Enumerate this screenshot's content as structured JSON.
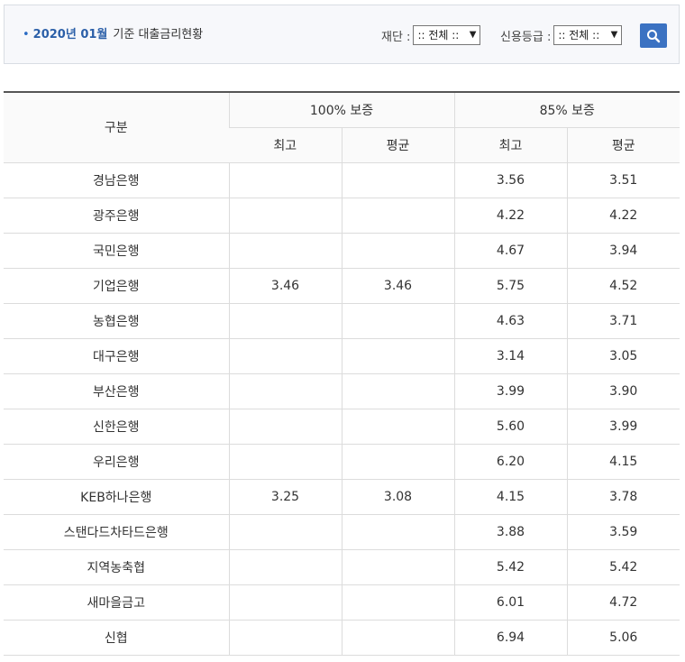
{
  "filter": {
    "bullet": "•",
    "date": "2020년 01월",
    "title": "기준 대출금리현황",
    "fund_label": "재단 :",
    "fund_value": ":: 전체 ::",
    "grade_label": "신용등급 :",
    "grade_value": ":: 전체 ::",
    "arrow": "▼",
    "search_icon": "search-icon",
    "accent_color": "#3b72c2"
  },
  "table": {
    "col_category": "구분",
    "group_100": "100% 보증",
    "group_85": "85% 보증",
    "max_label": "최고",
    "avg_label": "평균",
    "rows": [
      {
        "name": "경남은행",
        "g100_max": "",
        "g100_avg": "",
        "g85_max": "3.56",
        "g85_avg": "3.51"
      },
      {
        "name": "광주은행",
        "g100_max": "",
        "g100_avg": "",
        "g85_max": "4.22",
        "g85_avg": "4.22"
      },
      {
        "name": "국민은행",
        "g100_max": "",
        "g100_avg": "",
        "g85_max": "4.67",
        "g85_avg": "3.94"
      },
      {
        "name": "기업은행",
        "g100_max": "3.46",
        "g100_avg": "3.46",
        "g85_max": "5.75",
        "g85_avg": "4.52"
      },
      {
        "name": "농협은행",
        "g100_max": "",
        "g100_avg": "",
        "g85_max": "4.63",
        "g85_avg": "3.71"
      },
      {
        "name": "대구은행",
        "g100_max": "",
        "g100_avg": "",
        "g85_max": "3.14",
        "g85_avg": "3.05"
      },
      {
        "name": "부산은행",
        "g100_max": "",
        "g100_avg": "",
        "g85_max": "3.99",
        "g85_avg": "3.90"
      },
      {
        "name": "신한은행",
        "g100_max": "",
        "g100_avg": "",
        "g85_max": "5.60",
        "g85_avg": "3.99"
      },
      {
        "name": "우리은행",
        "g100_max": "",
        "g100_avg": "",
        "g85_max": "6.20",
        "g85_avg": "4.15"
      },
      {
        "name": "KEB하나은행",
        "g100_max": "3.25",
        "g100_avg": "3.08",
        "g85_max": "4.15",
        "g85_avg": "3.78"
      },
      {
        "name": "스탠다드차타드은행",
        "g100_max": "",
        "g100_avg": "",
        "g85_max": "3.88",
        "g85_avg": "3.59"
      },
      {
        "name": "지역농축협",
        "g100_max": "",
        "g100_avg": "",
        "g85_max": "5.42",
        "g85_avg": "5.42"
      },
      {
        "name": "새마을금고",
        "g100_max": "",
        "g100_avg": "",
        "g85_max": "6.01",
        "g85_avg": "4.72"
      },
      {
        "name": "신협",
        "g100_max": "",
        "g100_avg": "",
        "g85_max": "6.94",
        "g85_avg": "5.06"
      }
    ]
  }
}
